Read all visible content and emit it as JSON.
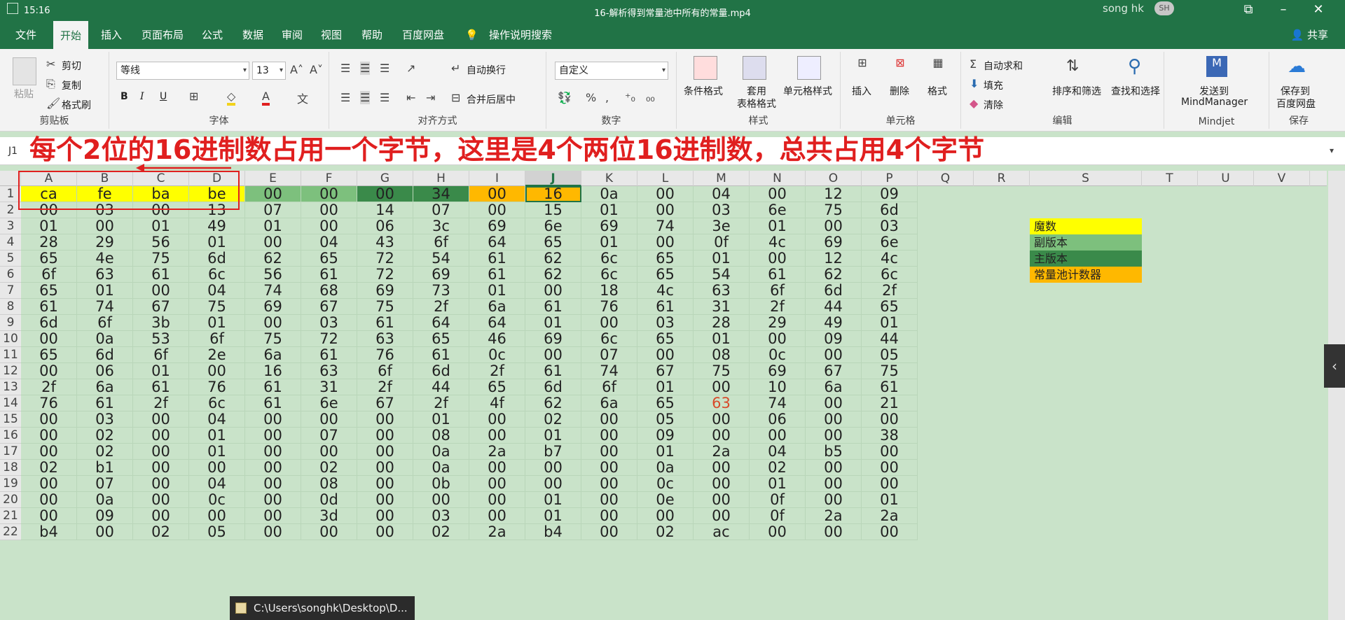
{
  "titlebar": {
    "time": "15:16",
    "title": "16-解析得到常量池中所有的常量.mp4",
    "user": "song hk",
    "avatar": "SH"
  },
  "menu": {
    "items": [
      "文件",
      "开始",
      "插入",
      "页面布局",
      "公式",
      "数据",
      "审阅",
      "视图",
      "帮助",
      "百度网盘"
    ],
    "active_index": 1,
    "tell_me": "操作说明搜索",
    "share": "共享"
  },
  "ribbon": {
    "clipboard": {
      "paste": "粘贴",
      "cut": "剪切",
      "copy": "复制",
      "format_painter": "格式刷",
      "label": "剪贴板"
    },
    "font": {
      "name": "等线",
      "size": "13",
      "bold": "B",
      "italic": "I",
      "underline": "U",
      "label": "字体"
    },
    "alignment": {
      "wrap": "自动换行",
      "merge": "合并后居中",
      "label": "对齐方式"
    },
    "number": {
      "format": "自定义",
      "label": "数字"
    },
    "styles": {
      "conditional": "条件格式",
      "table_line1": "套用",
      "table_line2": "表格格式",
      "cell_styles": "单元格样式",
      "label": "样式"
    },
    "cells": {
      "insert": "插入",
      "delete": "删除",
      "format": "格式",
      "label": "单元格"
    },
    "editing": {
      "autosum": "自动求和",
      "fill": "填充",
      "clear": "清除",
      "sort": "排序和筛选",
      "find": "查找和选择",
      "label": "编辑"
    },
    "mindjet": {
      "line1": "发送到",
      "line2": "MindManager",
      "label": "Mindjet"
    },
    "save": {
      "line1": "保存到",
      "line2": "百度网盘",
      "label": "保存"
    }
  },
  "formula_bar": {
    "name_box": "J1",
    "annotation": "每个2位的16进制数占用一个字节，这里是4个两位16进制数，总共占用4个字节",
    "fx_hint": "16"
  },
  "colors": {
    "magic": "#ffff00",
    "minor": "#7dc07d",
    "major": "#3a8a4a",
    "pool": "#ffb800",
    "annotation": "#e01f1f",
    "sheet_bg": "#c9e3c9"
  },
  "columns": [
    "A",
    "B",
    "C",
    "D",
    "E",
    "F",
    "G",
    "H",
    "I",
    "J",
    "K",
    "L",
    "M",
    "N",
    "O",
    "P",
    "Q",
    "R",
    "S",
    "T",
    "U",
    "V"
  ],
  "selected_column": "J",
  "grid": [
    [
      "ca",
      "fe",
      "ba",
      "be",
      "00",
      "00",
      "00",
      "34",
      "00",
      "16",
      "0a",
      "00",
      "04",
      "00",
      "12",
      "09"
    ],
    [
      "00",
      "03",
      "00",
      "13",
      "07",
      "00",
      "14",
      "07",
      "00",
      "15",
      "01",
      "00",
      "03",
      "6e",
      "75",
      "6d"
    ],
    [
      "01",
      "00",
      "01",
      "49",
      "01",
      "00",
      "06",
      "3c",
      "69",
      "6e",
      "69",
      "74",
      "3e",
      "01",
      "00",
      "03"
    ],
    [
      "28",
      "29",
      "56",
      "01",
      "00",
      "04",
      "43",
      "6f",
      "64",
      "65",
      "01",
      "00",
      "0f",
      "4c",
      "69",
      "6e"
    ],
    [
      "65",
      "4e",
      "75",
      "6d",
      "62",
      "65",
      "72",
      "54",
      "61",
      "62",
      "6c",
      "65",
      "01",
      "00",
      "12",
      "4c"
    ],
    [
      "6f",
      "63",
      "61",
      "6c",
      "56",
      "61",
      "72",
      "69",
      "61",
      "62",
      "6c",
      "65",
      "54",
      "61",
      "62",
      "6c"
    ],
    [
      "65",
      "01",
      "00",
      "04",
      "74",
      "68",
      "69",
      "73",
      "01",
      "00",
      "18",
      "4c",
      "63",
      "6f",
      "6d",
      "2f"
    ],
    [
      "61",
      "74",
      "67",
      "75",
      "69",
      "67",
      "75",
      "2f",
      "6a",
      "61",
      "76",
      "61",
      "31",
      "2f",
      "44",
      "65"
    ],
    [
      "6d",
      "6f",
      "3b",
      "01",
      "00",
      "03",
      "61",
      "64",
      "64",
      "01",
      "00",
      "03",
      "28",
      "29",
      "49",
      "01"
    ],
    [
      "00",
      "0a",
      "53",
      "6f",
      "75",
      "72",
      "63",
      "65",
      "46",
      "69",
      "6c",
      "65",
      "01",
      "00",
      "09",
      "44"
    ],
    [
      "65",
      "6d",
      "6f",
      "2e",
      "6a",
      "61",
      "76",
      "61",
      "0c",
      "00",
      "07",
      "00",
      "08",
      "0c",
      "00",
      "05"
    ],
    [
      "00",
      "06",
      "01",
      "00",
      "16",
      "63",
      "6f",
      "6d",
      "2f",
      "61",
      "74",
      "67",
      "75",
      "69",
      "67",
      "75"
    ],
    [
      "2f",
      "6a",
      "61",
      "76",
      "61",
      "31",
      "2f",
      "44",
      "65",
      "6d",
      "6f",
      "01",
      "00",
      "10",
      "6a",
      "61"
    ],
    [
      "76",
      "61",
      "2f",
      "6c",
      "61",
      "6e",
      "67",
      "2f",
      "4f",
      "62",
      "6a",
      "65",
      "63",
      "74",
      "00",
      "21"
    ],
    [
      "00",
      "03",
      "00",
      "04",
      "00",
      "00",
      "00",
      "01",
      "00",
      "02",
      "00",
      "05",
      "00",
      "06",
      "00",
      "00"
    ],
    [
      "00",
      "02",
      "00",
      "01",
      "00",
      "07",
      "00",
      "08",
      "00",
      "01",
      "00",
      "09",
      "00",
      "00",
      "00",
      "38"
    ],
    [
      "00",
      "02",
      "00",
      "01",
      "00",
      "00",
      "00",
      "0a",
      "2a",
      "b7",
      "00",
      "01",
      "2a",
      "04",
      "b5",
      "00"
    ],
    [
      "02",
      "b1",
      "00",
      "00",
      "00",
      "02",
      "00",
      "0a",
      "00",
      "00",
      "00",
      "0a",
      "00",
      "02",
      "00",
      "00"
    ],
    [
      "00",
      "07",
      "00",
      "04",
      "00",
      "08",
      "00",
      "0b",
      "00",
      "00",
      "00",
      "0c",
      "00",
      "01",
      "00",
      "00"
    ],
    [
      "00",
      "0a",
      "00",
      "0c",
      "00",
      "0d",
      "00",
      "00",
      "00",
      "01",
      "00",
      "0e",
      "00",
      "0f",
      "00",
      "01"
    ],
    [
      "00",
      "09",
      "00",
      "00",
      "00",
      "3d",
      "00",
      "03",
      "00",
      "01",
      "00",
      "00",
      "00",
      "0f",
      "2a",
      "2a"
    ],
    [
      "b4",
      "00",
      "02",
      "05",
      "00",
      "00",
      "00",
      "02",
      "2a",
      "b4",
      "00",
      "02",
      "ac",
      "00",
      "00",
      "00"
    ]
  ],
  "red_text_cell": {
    "row": 14,
    "col": 13
  },
  "legend": [
    {
      "label": "魔数",
      "color": "#ffff00"
    },
    {
      "label": "副版本",
      "color": "#7dc07d"
    },
    {
      "label": "主版本",
      "color": "#3a8a4a"
    },
    {
      "label": "常量池计数器",
      "color": "#ffb800"
    }
  ],
  "taskbar_popup": "C:\\Users\\songhk\\Desktop\\D..."
}
